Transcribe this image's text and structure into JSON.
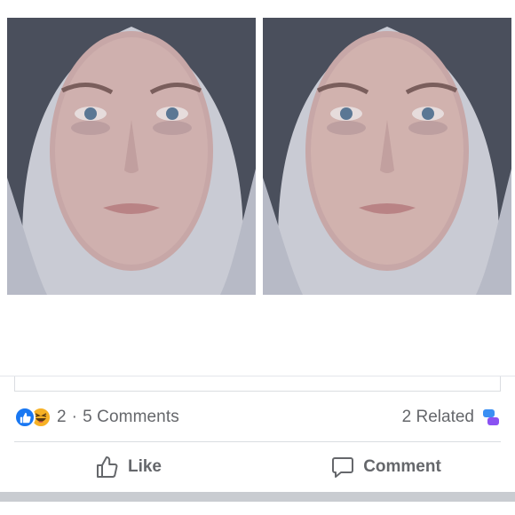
{
  "post": {
    "images": [
      {
        "name": "portrait-photo-left"
      },
      {
        "name": "portrait-photo-right"
      }
    ]
  },
  "stats": {
    "reaction_count": "2",
    "separator": "·",
    "comments_label": "5 Comments",
    "related_label": "2 Related",
    "reaction_icons": [
      "like-reaction-icon",
      "haha-reaction-icon"
    ]
  },
  "actions": {
    "like_label": "Like",
    "comment_label": "Comment"
  },
  "colors": {
    "like_blue": "#1877f2",
    "haha_yellow": "#f7b125",
    "text_gray": "#65676b",
    "divider": "#dadde1"
  }
}
